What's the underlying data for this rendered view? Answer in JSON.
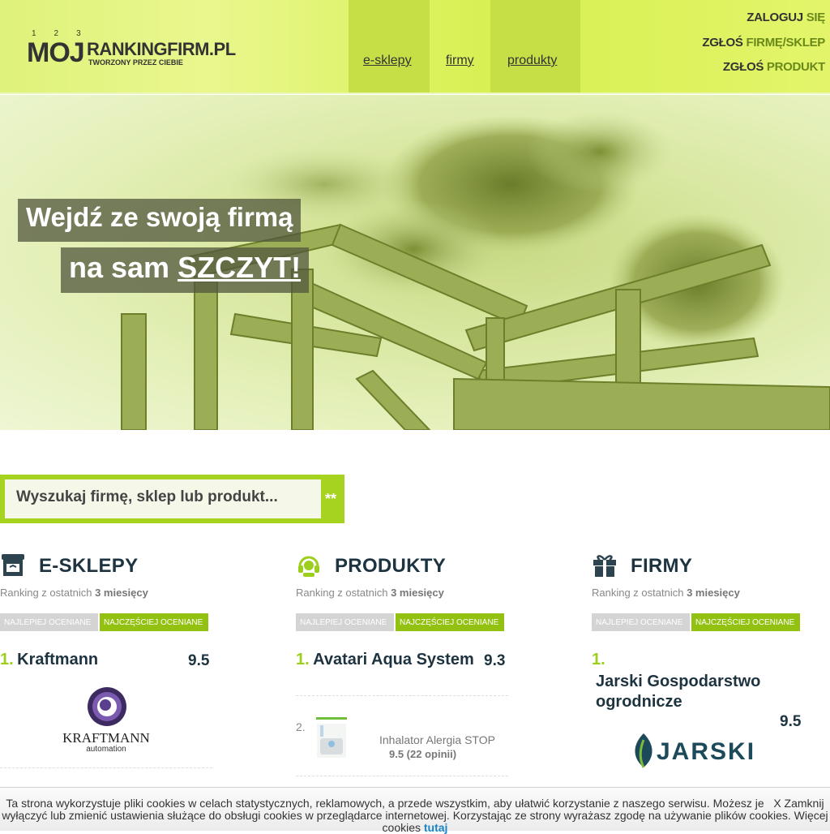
{
  "header": {
    "logo": {
      "nums": "123",
      "moj": "MOJ",
      "rank": "RANKINGFIRM.PL",
      "tagline": "TWORZONY PRZEZ CIEBIE"
    },
    "nav": [
      {
        "label": "e-sklepy"
      },
      {
        "label": "firmy"
      },
      {
        "label": "produkty"
      }
    ],
    "top_links": [
      {
        "dark": "ZALOGUJ",
        "accent": "SIĘ"
      },
      {
        "dark": "ZGŁOŚ",
        "accent": "FIRMĘ/SKLEP"
      },
      {
        "dark": "ZGŁOŚ",
        "accent": "PRODUKT"
      }
    ]
  },
  "hero": {
    "line1": "Wejdź ze swoją firmą",
    "line2_prefix": "na sam ",
    "line2_emph": "SZCZYT!"
  },
  "search": {
    "placeholder": "Wyszukaj firmę, sklep lub produkt...",
    "stars": "**"
  },
  "columns": {
    "esklepy": {
      "icon": "shop-icon",
      "title": "E-SKLEPY",
      "sub_prefix": "Ranking z ostatnich ",
      "sub_bold": "3 miesięcy",
      "tab_best": "NAJLEPIEJ OCENIANE",
      "tab_most": "NAJCZĘŚCIEJ OCENIANE",
      "item1": {
        "num": "1.",
        "name": "Kraftmann",
        "score": "9.5",
        "logo_text": "KRAFTMANN",
        "logo_sub": "automation"
      }
    },
    "produkty": {
      "icon": "headset-icon",
      "title": "PRODUKTY",
      "sub_prefix": "Ranking z ostatnich ",
      "sub_bold": "3 miesięcy",
      "tab_best": "NAJLEPIEJ OCENIANE",
      "tab_most": "NAJCZĘŚCIEJ OCENIANE",
      "item1": {
        "num": "1.",
        "name": "Avatari Aqua System",
        "score": "9.3"
      },
      "item2": {
        "num": "2.",
        "name": "Inhalator Alergia STOP",
        "rating": "9.5 (22 opinii)"
      }
    },
    "firmy": {
      "icon": "gift-icon",
      "title": "FIRMY",
      "sub_prefix": "Ranking z ostatnich ",
      "sub_bold": "3 miesięcy",
      "tab_best": "NAJLEPIEJ OCENIANE",
      "tab_most": "NAJCZĘŚCIEJ OCENIANE",
      "item1": {
        "num": "1.",
        "name": "Jarski Gospodarstwo ogrodnicze",
        "score": "9.5",
        "logo_text": "JARSKI"
      }
    }
  },
  "cookie": {
    "line1": "Ta strona wykorzystuje pliki cookies w celach statystycznych, reklamowych, a przede wszystkim, aby ułatwić korzystanie z naszego serwisu. Możesz je",
    "close": "X Zamknij",
    "line2": "wyłączyć lub zmienić ustawienia służące do obsługi cookies w przeglądarce internetowej. Korzystając ze strony wyrażasz zgodę na używanie plików cookies. Więcej",
    "line3": "cookies",
    "link": "tutaj"
  }
}
